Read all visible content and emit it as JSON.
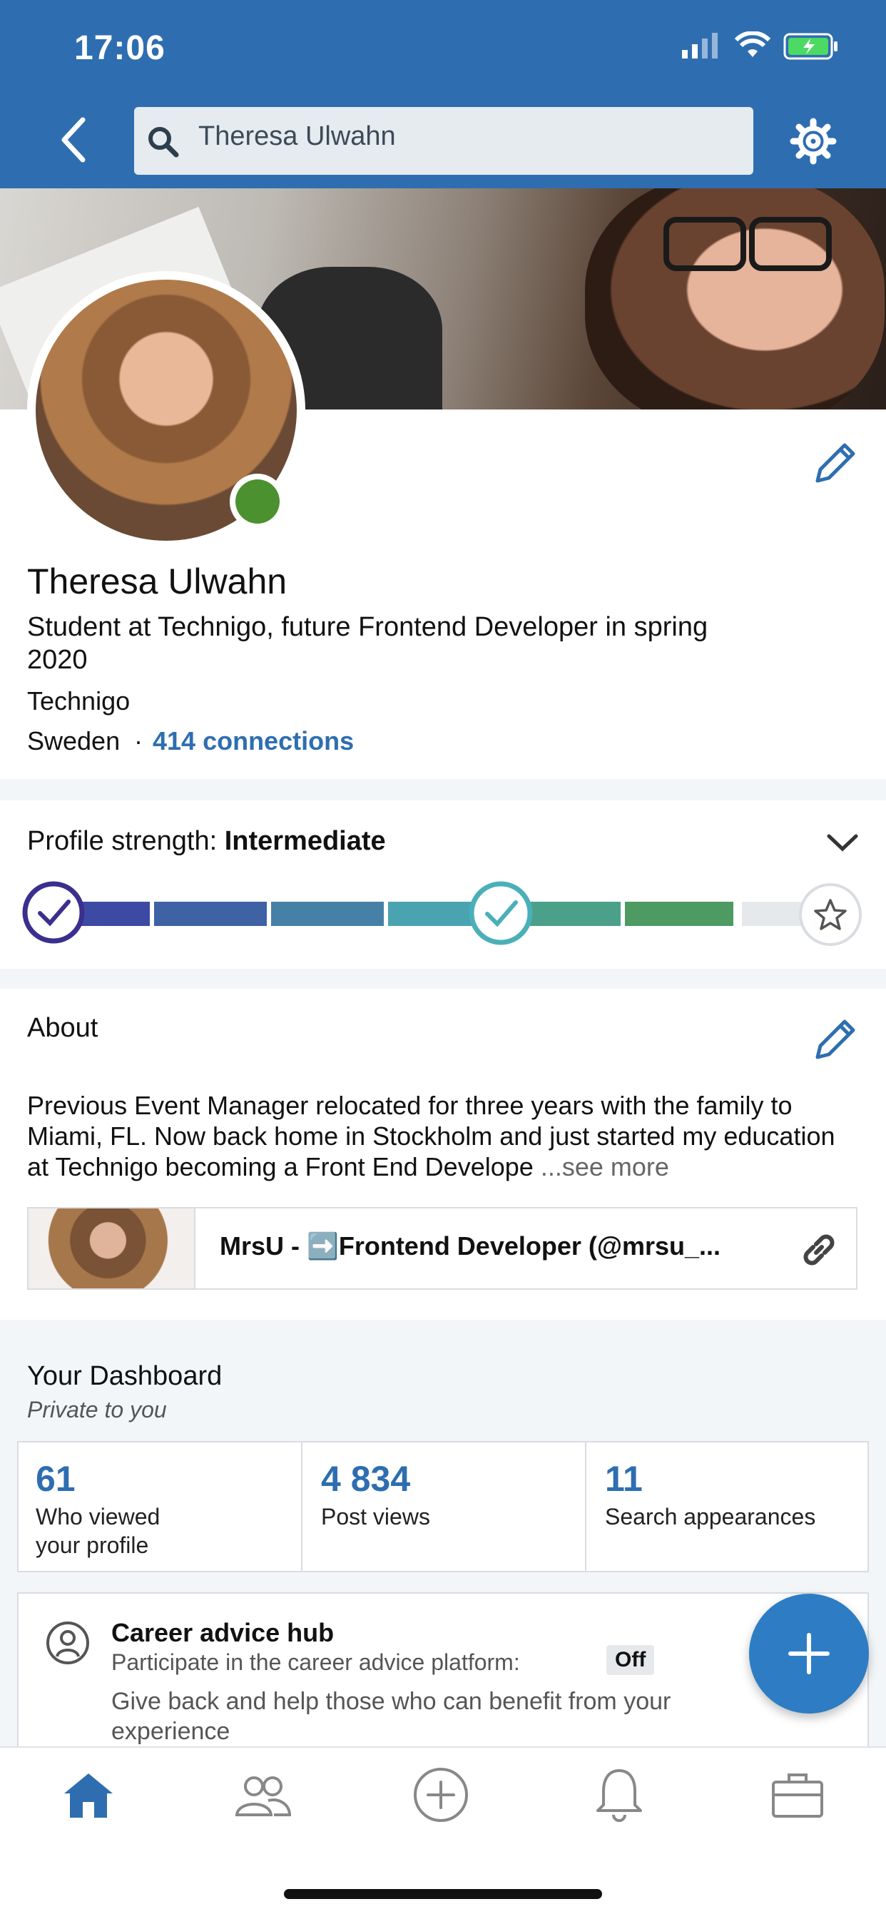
{
  "status_bar": {
    "time": "17:06"
  },
  "search": {
    "query": "Theresa Ulwahn"
  },
  "profile": {
    "name": "Theresa Ulwahn",
    "headline": "Student at Technigo, future Frontend Developer in spring 2020",
    "company": "Technigo",
    "location": "Sweden",
    "separator": "·",
    "connections": "414 connections"
  },
  "profile_strength": {
    "label": "Profile strength:",
    "level": "Intermediate"
  },
  "about": {
    "title": "About",
    "text": "Previous Event Manager relocated for three years with the family to Miami, FL. Now back home in Stockholm and just started my education at Technigo becoming a Front End Develope",
    "see_more": "...see more",
    "media_title": "MrsU - ➡️Frontend Developer (@mrsu_..."
  },
  "dashboard": {
    "title": "Your Dashboard",
    "subtitle": "Private to you",
    "stats": [
      {
        "value": "61",
        "label": "Who viewed your profile"
      },
      {
        "value": "4 834",
        "label": "Post views"
      },
      {
        "value": "11",
        "label": "Search appearances"
      }
    ],
    "career": {
      "title": "Career advice hub",
      "participate": "Participate in the career advice platform:",
      "status": "Off",
      "description": "Give back and help those who can benefit from your experience"
    }
  },
  "colors": {
    "brand": "#2e6eb0",
    "online": "#4c9130",
    "accent_teal": "#4ab0b8"
  },
  "icons": [
    "back-chevron-icon",
    "search-icon",
    "gear-icon",
    "edit-pencil-icon",
    "chevron-down-icon",
    "check-icon",
    "star-icon",
    "link-icon",
    "career-hub-icon",
    "plus-icon",
    "home-icon",
    "network-icon",
    "post-icon",
    "notifications-icon",
    "jobs-icon"
  ]
}
